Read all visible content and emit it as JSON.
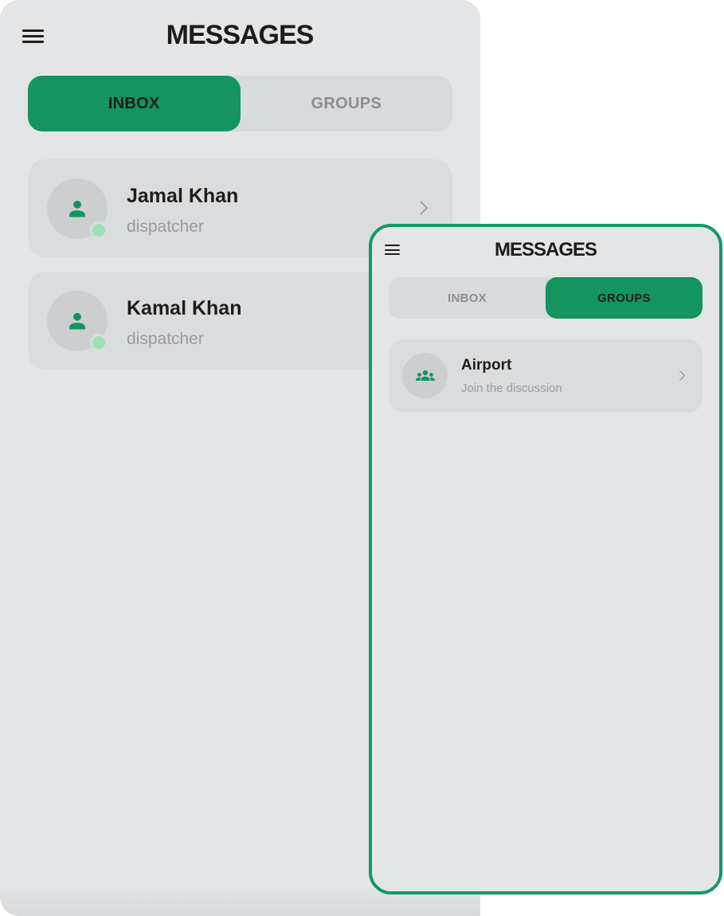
{
  "back_screen": {
    "title": "MESSAGES",
    "tabs": [
      {
        "label": "INBOX",
        "active": true
      },
      {
        "label": "GROUPS",
        "active": false
      }
    ],
    "contacts": [
      {
        "name": "Jamal Khan",
        "role": "dispatcher",
        "status": "online"
      },
      {
        "name": "Kamal Khan",
        "role": "dispatcher",
        "status": "online"
      }
    ]
  },
  "front_screen": {
    "title": "MESSAGES",
    "tabs": [
      {
        "label": "INBOX",
        "active": false
      },
      {
        "label": "GROUPS",
        "active": true
      }
    ],
    "groups": [
      {
        "name": "Airport",
        "subtitle": "Join the discussion"
      }
    ]
  },
  "colors": {
    "accent": "#139460",
    "background": "#e4e5e7",
    "card": "#dbdcde",
    "online_dot": "#9be2b2"
  },
  "icons": {
    "menu": "hamburger-menu-icon",
    "person": "person-icon",
    "group": "group-icon",
    "chevron": "chevron-right-icon"
  }
}
